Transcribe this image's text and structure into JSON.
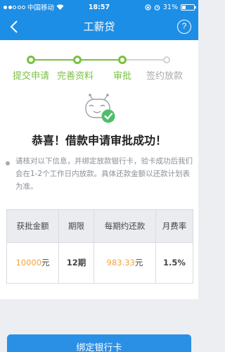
{
  "status_bar": {
    "carrier": "中国移动",
    "time": "18:57",
    "battery": "31%",
    "battery_level": 0.31
  },
  "nav": {
    "title": "工薪贷",
    "help_icon": "?"
  },
  "steps": [
    {
      "label": "提交申请",
      "done": true
    },
    {
      "label": "完善资料",
      "done": true
    },
    {
      "label": "审批",
      "done": true
    },
    {
      "label": "签约放款",
      "done": false
    }
  ],
  "result": {
    "title": "恭喜！借款申请审批成功！",
    "notice": "请核对以下信息，并绑定放款银行卡，验卡成功后我们会在1-2个工作日内放款。具体还款金额以还款计划表为准。"
  },
  "loan_table": {
    "headers": [
      "获批金额",
      "期限",
      "每期约还款",
      "月费率"
    ],
    "row": {
      "amount": "10000",
      "amount_unit": "元",
      "term": "12期",
      "installment": "983.33",
      "installment_unit": "元",
      "rate": "1.5%"
    }
  },
  "actions": {
    "bind_card": "绑定银行卡"
  },
  "colors": {
    "primary": "#1d8ee6",
    "success": "#7ac142",
    "amount": "#f3a33f"
  }
}
